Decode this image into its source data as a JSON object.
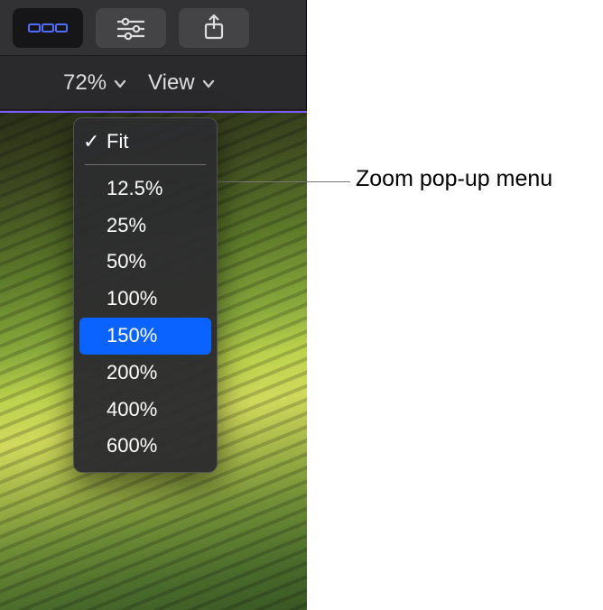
{
  "toolbar": {
    "clips_icon": "filmstrip-icon",
    "adjust_icon": "sliders-icon",
    "share_icon": "share-icon"
  },
  "subbar": {
    "zoom_label": "72%",
    "view_label": "View"
  },
  "zoom_menu": {
    "fit": "Fit",
    "items": [
      "12.5%",
      "25%",
      "50%",
      "100%",
      "150%",
      "200%",
      "400%",
      "600%"
    ],
    "highlighted": "150%"
  },
  "annotation": {
    "label": "Zoom pop-up menu"
  }
}
